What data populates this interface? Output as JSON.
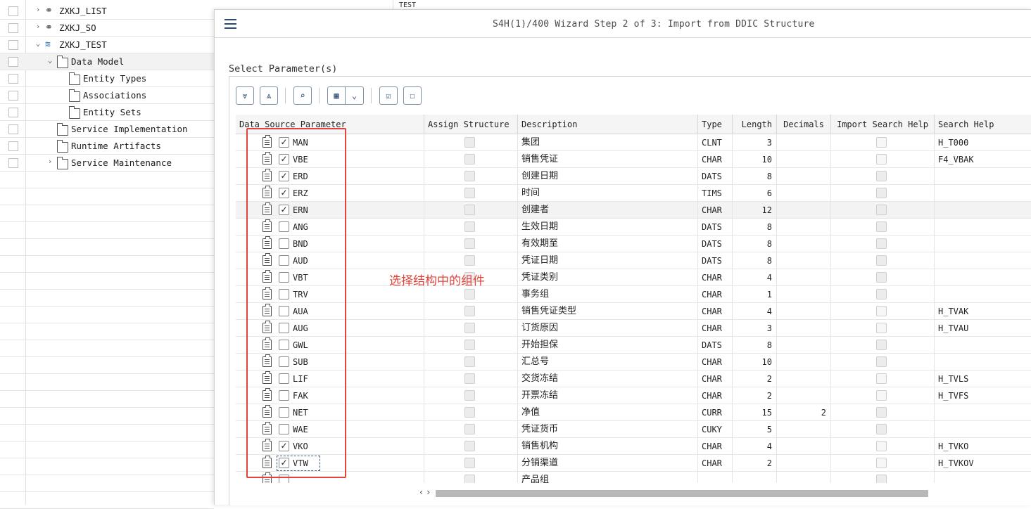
{
  "tree": {
    "items": [
      {
        "label": "ZXKJ_LIST",
        "arrow": "›",
        "icon": "glasses"
      },
      {
        "label": "ZXKJ_SO",
        "arrow": "›",
        "icon": "glasses"
      },
      {
        "label": "ZXKJ_TEST",
        "arrow": "⌄",
        "icon": "stack"
      },
      {
        "label": "Data Model",
        "arrow": "⌄",
        "icon": "model"
      },
      {
        "label": "Entity Types",
        "arrow": "",
        "icon": "folder"
      },
      {
        "label": "Associations",
        "arrow": "",
        "icon": "folder"
      },
      {
        "label": "Entity Sets",
        "arrow": "",
        "icon": "folder"
      },
      {
        "label": "Service Implementation",
        "arrow": "",
        "icon": "folder"
      },
      {
        "label": "Runtime Artifacts",
        "arrow": "",
        "icon": "folder"
      },
      {
        "label": "Service Maintenance",
        "arrow": "›",
        "icon": "folder"
      }
    ]
  },
  "background_strip": "TEST",
  "dialog": {
    "title": "S4H(1)/400 Wizard Step 2 of 3: Import from DDIC Structure",
    "section_label": "Select Parameter(s)"
  },
  "toolbar": {
    "expand_all": "⩔",
    "collapse_all": "⩓",
    "find": "⌕",
    "layout": "▦",
    "layout_menu": "⌄",
    "select_all": "☑",
    "deselect_all": "☐"
  },
  "table": {
    "columns": {
      "source": "Data Source Parameter",
      "assign": "Assign Structure",
      "description": "Description",
      "type": "Type",
      "length": "Length",
      "decimals": "Decimals",
      "import_sh": "Import Search Help",
      "search_help": "Search Help"
    },
    "rows": [
      {
        "field": "MAN",
        "checked": true,
        "description": "集团",
        "type": "CLNT",
        "length": "3",
        "decimals": "",
        "sh_enabled": true,
        "search_help": "H_T000"
      },
      {
        "field": "VBE",
        "checked": true,
        "description": "销售凭证",
        "type": "CHAR",
        "length": "10",
        "decimals": "",
        "sh_enabled": true,
        "search_help": "F4_VBAK"
      },
      {
        "field": "ERD",
        "checked": true,
        "description": "创建日期",
        "type": "DATS",
        "length": "8",
        "decimals": "",
        "sh_enabled": false,
        "search_help": ""
      },
      {
        "field": "ERZ",
        "checked": true,
        "description": "时间",
        "type": "TIMS",
        "length": "6",
        "decimals": "",
        "sh_enabled": false,
        "search_help": ""
      },
      {
        "field": "ERN",
        "checked": true,
        "description": "创建者",
        "type": "CHAR",
        "length": "12",
        "decimals": "",
        "sh_enabled": false,
        "search_help": ""
      },
      {
        "field": "ANG",
        "checked": false,
        "description": "生效日期",
        "type": "DATS",
        "length": "8",
        "decimals": "",
        "sh_enabled": false,
        "search_help": ""
      },
      {
        "field": "BND",
        "checked": false,
        "description": "有效期至",
        "type": "DATS",
        "length": "8",
        "decimals": "",
        "sh_enabled": false,
        "search_help": ""
      },
      {
        "field": "AUD",
        "checked": false,
        "description": "凭证日期",
        "type": "DATS",
        "length": "8",
        "decimals": "",
        "sh_enabled": false,
        "search_help": ""
      },
      {
        "field": "VBT",
        "checked": false,
        "description": "凭证类别",
        "type": "CHAR",
        "length": "4",
        "decimals": "",
        "sh_enabled": false,
        "search_help": ""
      },
      {
        "field": "TRV",
        "checked": false,
        "description": "事务组",
        "type": "CHAR",
        "length": "1",
        "decimals": "",
        "sh_enabled": false,
        "search_help": ""
      },
      {
        "field": "AUA",
        "checked": false,
        "description": "销售凭证类型",
        "type": "CHAR",
        "length": "4",
        "decimals": "",
        "sh_enabled": true,
        "search_help": "H_TVAK"
      },
      {
        "field": "AUG",
        "checked": false,
        "description": "订货原因",
        "type": "CHAR",
        "length": "3",
        "decimals": "",
        "sh_enabled": true,
        "search_help": "H_TVAU"
      },
      {
        "field": "GWL",
        "checked": false,
        "description": "开始担保",
        "type": "DATS",
        "length": "8",
        "decimals": "",
        "sh_enabled": false,
        "search_help": ""
      },
      {
        "field": "SUB",
        "checked": false,
        "description": "汇总号",
        "type": "CHAR",
        "length": "10",
        "decimals": "",
        "sh_enabled": false,
        "search_help": ""
      },
      {
        "field": "LIF",
        "checked": false,
        "description": "交货冻结",
        "type": "CHAR",
        "length": "2",
        "decimals": "",
        "sh_enabled": true,
        "search_help": "H_TVLS"
      },
      {
        "field": "FAK",
        "checked": false,
        "description": "开票冻结",
        "type": "CHAR",
        "length": "2",
        "decimals": "",
        "sh_enabled": true,
        "search_help": "H_TVFS"
      },
      {
        "field": "NET",
        "checked": false,
        "description": "净值",
        "type": "CURR",
        "length": "15",
        "decimals": "2",
        "sh_enabled": false,
        "search_help": ""
      },
      {
        "field": "WAE",
        "checked": false,
        "description": "凭证货币",
        "type": "CUKY",
        "length": "5",
        "decimals": "",
        "sh_enabled": false,
        "search_help": ""
      },
      {
        "field": "VKO",
        "checked": true,
        "description": "销售机构",
        "type": "CHAR",
        "length": "4",
        "decimals": "",
        "sh_enabled": true,
        "search_help": "H_TVKO"
      },
      {
        "field": "VTW",
        "checked": true,
        "description": "分销渠道",
        "type": "CHAR",
        "length": "2",
        "decimals": "",
        "sh_enabled": true,
        "search_help": "H_TVKOV"
      },
      {
        "field": "",
        "checked": false,
        "description": "产品组",
        "type": "",
        "length": "",
        "decimals": "",
        "sh_enabled": false,
        "search_help": ""
      }
    ]
  },
  "annotation": "选择结构中的组件",
  "colors": {
    "accent": "#2b4a73",
    "annotation": "#e0443b"
  }
}
